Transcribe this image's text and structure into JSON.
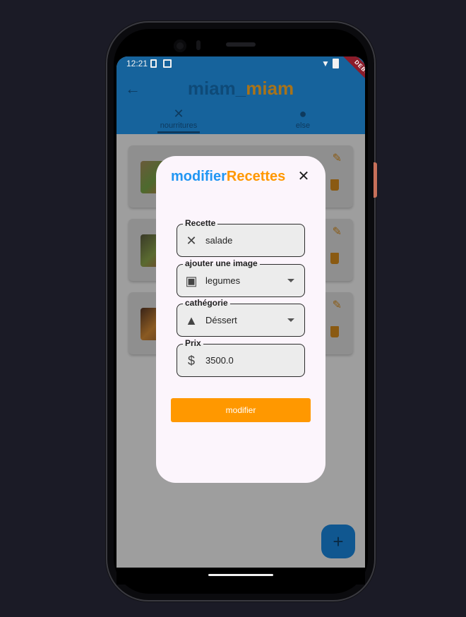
{
  "status_bar": {
    "time": "12:21",
    "debug_label": "DEBUG"
  },
  "app_bar": {
    "title_part1": "miam_",
    "title_part2": "miam",
    "tabs": [
      {
        "label": "nourritures",
        "icon": "restaurant-icon"
      },
      {
        "label": "else",
        "icon": "person-icon"
      }
    ]
  },
  "list": {
    "cards": [
      {
        "image": "salad-photo",
        "actions": [
          "edit-icon",
          "delete-icon"
        ]
      },
      {
        "image": "salad-photo",
        "actions": [
          "edit-icon",
          "delete-icon"
        ]
      },
      {
        "image": "burger-photo",
        "actions": [
          "edit-icon",
          "delete-icon"
        ]
      }
    ]
  },
  "fab": {
    "label": "+"
  },
  "dialog": {
    "title_part1": "modifier",
    "title_part2": "Recettes",
    "close_label": "✕",
    "fields": {
      "recette": {
        "label": "Recette",
        "value": "salade",
        "icon": "restaurant-icon"
      },
      "image": {
        "label": "ajouter une image",
        "value": "legumes",
        "icon": "image-icon"
      },
      "categorie": {
        "label": "cathégorie",
        "value": "Déssert",
        "icon": "category-icon"
      },
      "prix": {
        "label": "Prix",
        "value": "3500.0",
        "icon": "dollar-icon"
      }
    },
    "submit_label": "modifier"
  },
  "colors": {
    "blue": "#2196f3",
    "orange": "#ff9800",
    "app_bar": "#16639c",
    "dialog_bg": "#fcf5fc"
  }
}
